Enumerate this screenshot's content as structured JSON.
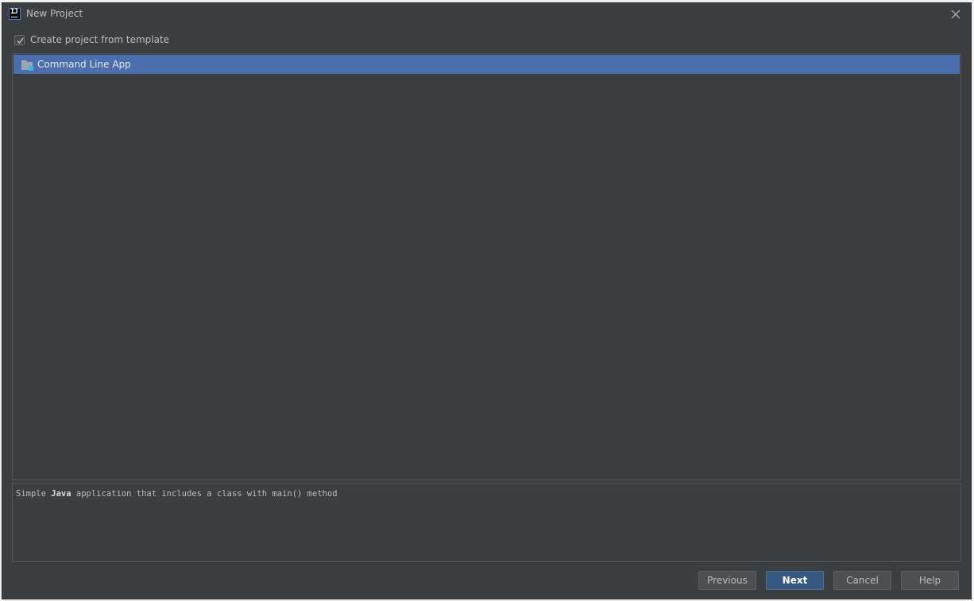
{
  "window": {
    "title": "New Project",
    "app_icon_text": "IJ"
  },
  "template_option": {
    "label": "Create project from template",
    "checked": true
  },
  "templates": [
    {
      "label": "Command Line App",
      "selected": true
    }
  ],
  "description": {
    "prefix": "Simple ",
    "emphasis": "Java",
    "suffix": " application that includes a class with main() method"
  },
  "buttons": {
    "previous": "Previous",
    "next": "Next",
    "cancel": "Cancel",
    "help": "Help"
  },
  "colors": {
    "background": "#3c3f41",
    "selection": "#4b6eaf",
    "default_button": "#365880"
  }
}
